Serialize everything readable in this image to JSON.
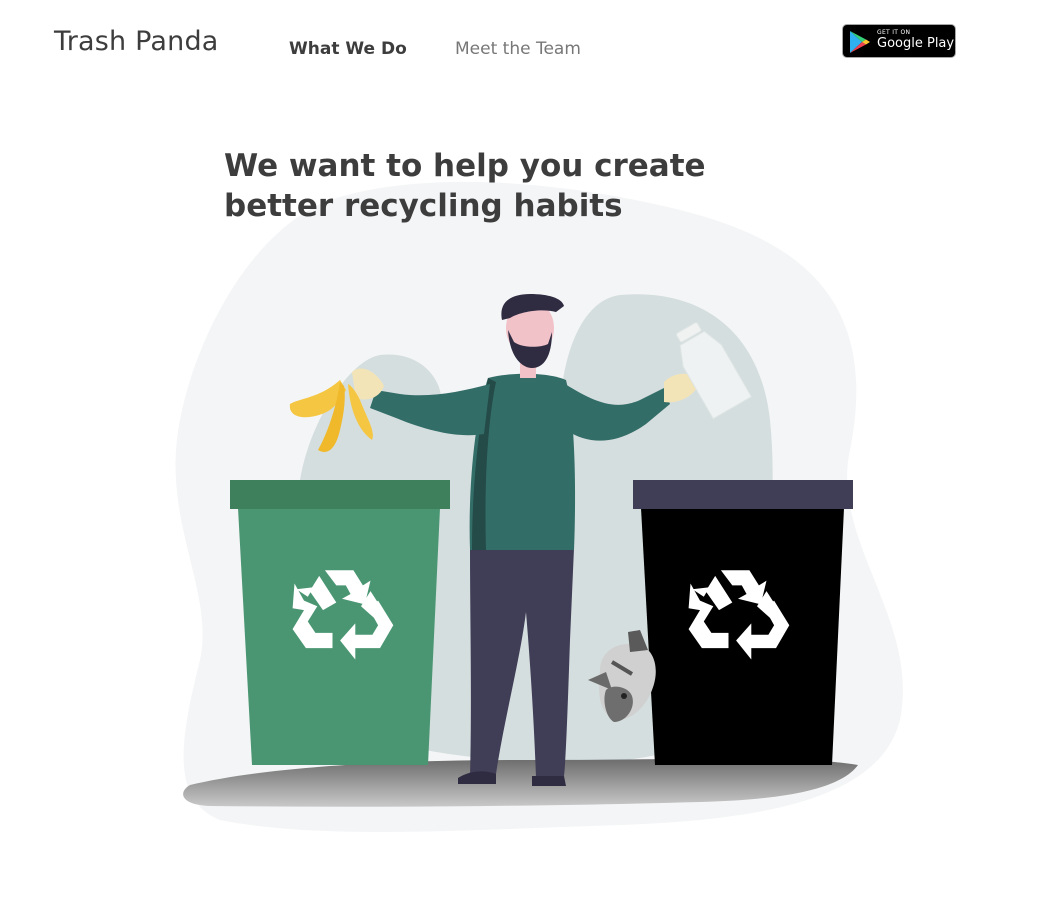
{
  "header": {
    "brand": "Trash Panda",
    "nav": {
      "what_we_do": "What We Do",
      "meet_the_team": "Meet the Team"
    },
    "google_play": {
      "small_text": "GET IT ON",
      "big_text": "Google Play"
    }
  },
  "hero": {
    "title": "We want to help you create better recycling habits"
  },
  "colors": {
    "text_dark": "#3d3d3d",
    "text_muted": "#777777",
    "green_bin": "#4a9673",
    "green_bin_lid": "#3d805b",
    "black_bin": "#000000",
    "black_bin_lid": "#403d56",
    "sweater": "#336d68",
    "pants": "#403d56",
    "backdrop": "#f4f5f6",
    "backdrop_inner": "#d5dede"
  },
  "icons": {
    "recycle": "recycle-icon",
    "play_store": "google-play-icon"
  }
}
